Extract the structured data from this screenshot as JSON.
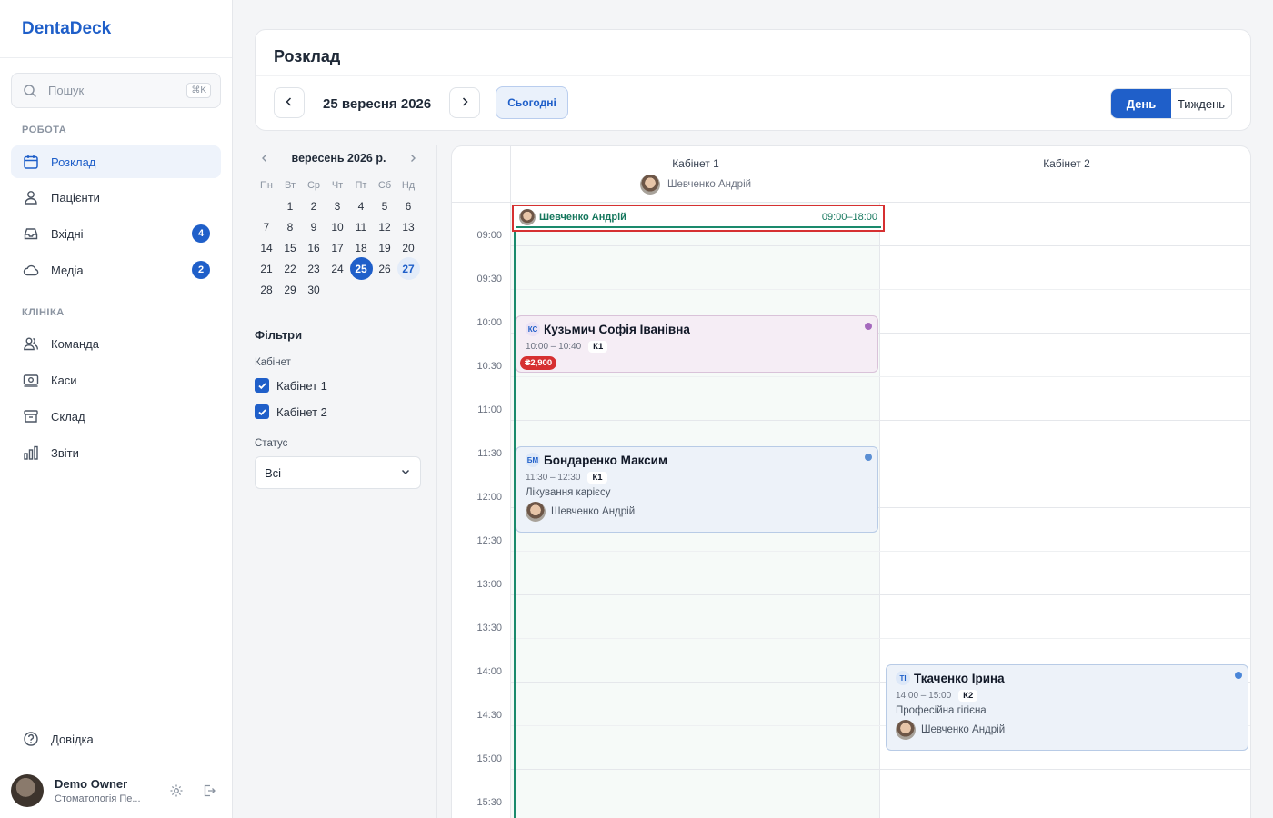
{
  "app": {
    "brand": "DentaDeck"
  },
  "search": {
    "placeholder": "Пошук",
    "shortcut": "⌘K"
  },
  "sidebar": {
    "sections": [
      {
        "label": "РОБОТА"
      },
      {
        "label": "КЛІНІКА"
      }
    ],
    "work_items": [
      {
        "label": "Розклад",
        "icon": "calendar-icon",
        "active": true
      },
      {
        "label": "Пацієнти",
        "icon": "patients-icon"
      },
      {
        "label": "Вхідні",
        "icon": "inbox-icon",
        "badge": "4"
      },
      {
        "label": "Медіа",
        "icon": "cloud-icon",
        "badge": "2"
      }
    ],
    "clinic_items": [
      {
        "label": "Команда",
        "icon": "team-icon"
      },
      {
        "label": "Каси",
        "icon": "cashbox-icon"
      },
      {
        "label": "Склад",
        "icon": "warehouse-icon"
      },
      {
        "label": "Звіти",
        "icon": "reports-icon"
      }
    ],
    "help": "Довідка",
    "user": {
      "name": "Demo Owner",
      "org": "Стоматологія Пе..."
    }
  },
  "header": {
    "title": "Розклад",
    "date": "25 вересня 2026",
    "today": "Сьогодні",
    "view_day": "День",
    "view_week": "Тиждень"
  },
  "mini_calendar": {
    "month": "вересень 2026 р.",
    "weekdays": [
      "Пн",
      "Вт",
      "Ср",
      "Чт",
      "Пт",
      "Сб",
      "Нд"
    ],
    "leading_blanks": 1,
    "days": [
      "1",
      "2",
      "3",
      "4",
      "5",
      "6",
      "7",
      "8",
      "9",
      "10",
      "11",
      "12",
      "13",
      "14",
      "15",
      "16",
      "17",
      "18",
      "19",
      "20",
      "21",
      "22",
      "23",
      "24",
      "25",
      "26",
      "27",
      "28",
      "29",
      "30"
    ],
    "selected": "25",
    "highlighted": "27"
  },
  "filters": {
    "title": "Фільтри",
    "cabinet_label": "Кабінет",
    "cabinets": [
      {
        "label": "Кабінет 1",
        "checked": true
      },
      {
        "label": "Кабінет 2",
        "checked": true
      }
    ],
    "status_label": "Статус",
    "status_value": "Всі"
  },
  "schedule": {
    "columns": [
      {
        "name": "Кабінет 1",
        "doctor": "Шевченко Андрій"
      },
      {
        "name": "Кабінет 2",
        "doctor": ""
      }
    ],
    "times": [
      "09:00",
      "09:30",
      "10:00",
      "10:30",
      "11:00",
      "11:30",
      "12:00",
      "12:30",
      "13:00",
      "13:30",
      "14:00",
      "14:30",
      "15:00",
      "15:30"
    ],
    "shift": {
      "doctor": "Шевченко Андрій",
      "time": "09:00–18:00"
    },
    "appointments": [
      {
        "initials": "КС",
        "patient": "Кузьмич Софія Іванівна",
        "time": "10:00 – 10:40",
        "cabinet": "К1",
        "price": "₴2,900",
        "status_color": "#a569bd"
      },
      {
        "initials": "БМ",
        "patient": "Бондаренко Максим",
        "time": "11:30 – 12:30",
        "cabinet": "К1",
        "procedure": "Лікування карієсу",
        "doctor": "Шевченко Андрій",
        "status_color": "#5b8fd4"
      },
      {
        "initials": "ТІ",
        "patient": "Ткаченко Ірина",
        "time": "14:00 – 15:00",
        "cabinet": "К2",
        "procedure": "Професійна гігієна",
        "doctor": "Шевченко Андрій",
        "status_color": "#4a86d8"
      }
    ]
  },
  "colors": {
    "accent": "#1f5fc9",
    "shift_green": "#1a8a6c",
    "danger": "#d63031"
  }
}
